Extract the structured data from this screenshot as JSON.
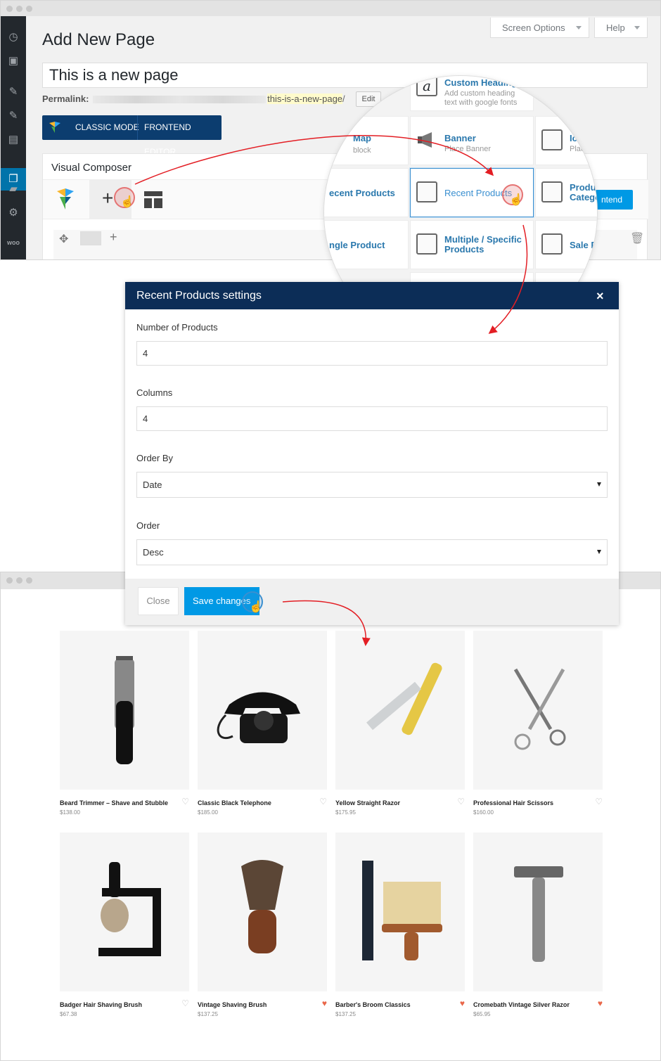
{
  "admin": {
    "page_title": "Add New Page",
    "screen_options": "Screen Options",
    "help": "Help",
    "title_value": "This is a new page",
    "permalink_label": "Permalink:",
    "permalink_slug": "this-is-a-new-page",
    "permalink_suffix": "/",
    "edit_label": "Edit",
    "classic_mode": "CLASSIC MODE",
    "frontend_editor": "FRONTEND EDITOR",
    "vc_title": "Visual Composer",
    "frontend_partial": "ntend"
  },
  "elements_panel": [
    {
      "name": "Custom Heading",
      "desc": "Add custom heading text with google fonts",
      "icon": "letter-a-icon"
    },
    {
      "name": "Map",
      "desc": "block",
      "icon": "map-icon"
    },
    {
      "name": "Banner",
      "desc": "Place Banner",
      "icon": "megaphone-icon"
    },
    {
      "name": "Ico",
      "desc": "Place",
      "icon": "id-card-icon"
    },
    {
      "name": "ecent Products",
      "desc": "",
      "icon": ""
    },
    {
      "name": "Recent Products",
      "desc": "",
      "icon": "box-clock-icon"
    },
    {
      "name": "Product Category",
      "desc": "",
      "icon": "box-folder-icon"
    },
    {
      "name": "ngle Product",
      "desc": "",
      "icon": ""
    },
    {
      "name": "Multiple / Specific Products",
      "desc": "",
      "icon": "box-id-icon"
    },
    {
      "name": "Sale Pro",
      "desc": "",
      "icon": "box-percent-icon"
    }
  ],
  "dialog": {
    "title": "Recent Products settings",
    "close_x": "×",
    "number_label": "Number of Products",
    "number_value": "4",
    "columns_label": "Columns",
    "columns_value": "4",
    "orderby_label": "Order By",
    "orderby_value": "Date",
    "order_label": "Order",
    "order_value": "Desc",
    "close_button": "Close",
    "save_button": "Save changes"
  },
  "products": [
    {
      "name": "Beard Trimmer – Shave and Stubble",
      "price": "$138.00",
      "favorited": false,
      "image": "trimmer-icon"
    },
    {
      "name": "Classic Black Telephone",
      "price": "$185.00",
      "favorited": false,
      "image": "telephone-icon"
    },
    {
      "name": "Yellow Straight Razor",
      "price": "$175.95",
      "favorited": false,
      "image": "razor-icon"
    },
    {
      "name": "Professional Hair Scissors",
      "price": "$160.00",
      "favorited": false,
      "image": "scissors-icon"
    },
    {
      "name": "Badger Hair Shaving Brush",
      "price": "$67.38",
      "favorited": false,
      "image": "shaving-brush-stand-icon"
    },
    {
      "name": "Vintage Shaving Brush",
      "price": "$137.25",
      "favorited": true,
      "image": "shaving-brush-icon"
    },
    {
      "name": "Barber's Broom Classics",
      "price": "$137.25",
      "favorited": true,
      "image": "comb-broom-icon"
    },
    {
      "name": "Cromebath Vintage Silver Razor",
      "price": "$65.95",
      "favorited": true,
      "image": "safety-razor-icon"
    }
  ],
  "colors": {
    "admin_sidebar": "#23282d",
    "accent_blue": "#0073aa",
    "dialog_header": "#0c2d57",
    "save_button": "#0099e5",
    "arrow_red": "#e31e24",
    "heart_active": "#e9674a"
  }
}
